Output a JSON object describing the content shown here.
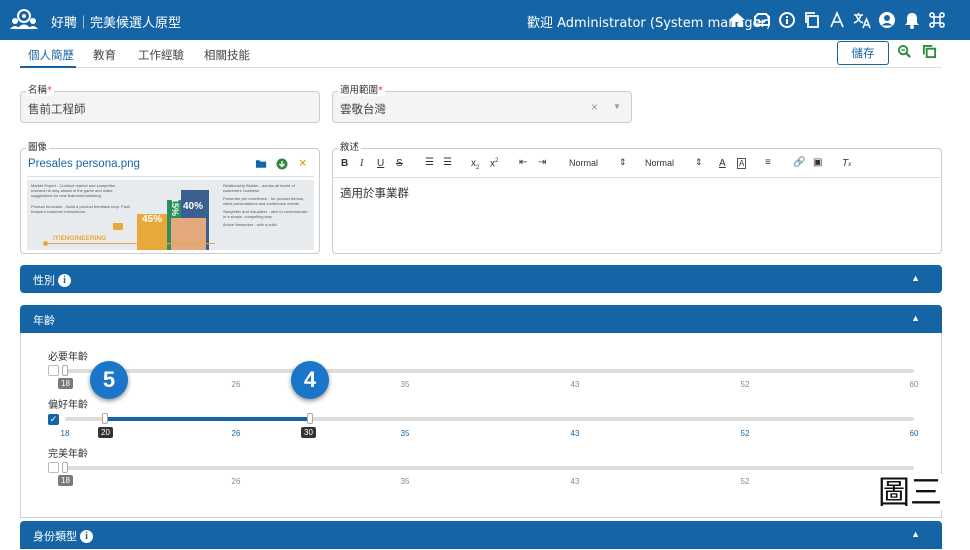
{
  "header": {
    "title": "好聘｜完美候選人原型",
    "welcome": "歡迎 Administrator (System manager)"
  },
  "tabs": [
    "個人簡歷",
    "教育",
    "工作經驗",
    "相關技能"
  ],
  "toolbar": {
    "save_label": "儲存"
  },
  "form": {
    "name": {
      "label": "名稱",
      "value": "售前工程師"
    },
    "scope": {
      "label": "適用範圍",
      "value": "雲敬台灣"
    },
    "image": {
      "label": "圖像",
      "filename": "Presales persona.png"
    },
    "description": {
      "label": "敘述",
      "value": "適用於事業群",
      "format1": "Normal",
      "format2": "Normal"
    }
  },
  "persona_image": {
    "category": "IT/ENGINEERING",
    "pct1": "45%",
    "pct2": "15%",
    "pct3": "40%",
    "lines": [
      "Market Expert - Conduct market and competitor research to stay ahead of the game and make suggestions for new features/marketing.",
      "Product Innovator - Build a product feedback loop. Push frequent customer interactions."
    ],
    "lines_right": [
      "Relationship Builder - across all levels of customers' business",
      "Presenter per excellence - for product demos, client presentations and conference events",
      "Storyteller and Visualizer - able to communicate in a simple, compelling way",
      "Active Networker - with a solid"
    ]
  },
  "sections": {
    "gender": "性別",
    "age": "年齡",
    "identity": "身份類型"
  },
  "sliders": [
    {
      "label": "必要年齡",
      "enabled": false,
      "badge": "18",
      "ticks": [
        "18",
        "26",
        "35",
        "43",
        "52",
        "60"
      ]
    },
    {
      "label": "偏好年齡",
      "enabled": true,
      "low": "20",
      "high": "30",
      "ticks": [
        "18",
        "26",
        "35",
        "43",
        "52",
        "60"
      ]
    },
    {
      "label": "完美年齡",
      "enabled": false,
      "badge": "18",
      "ticks": [
        "18",
        "26",
        "35",
        "43",
        "52",
        "60"
      ]
    }
  ],
  "markers": [
    "5",
    "4"
  ],
  "caption": "圖三",
  "colors": {
    "primary": "#1565a6",
    "marker": "#1976c8"
  }
}
